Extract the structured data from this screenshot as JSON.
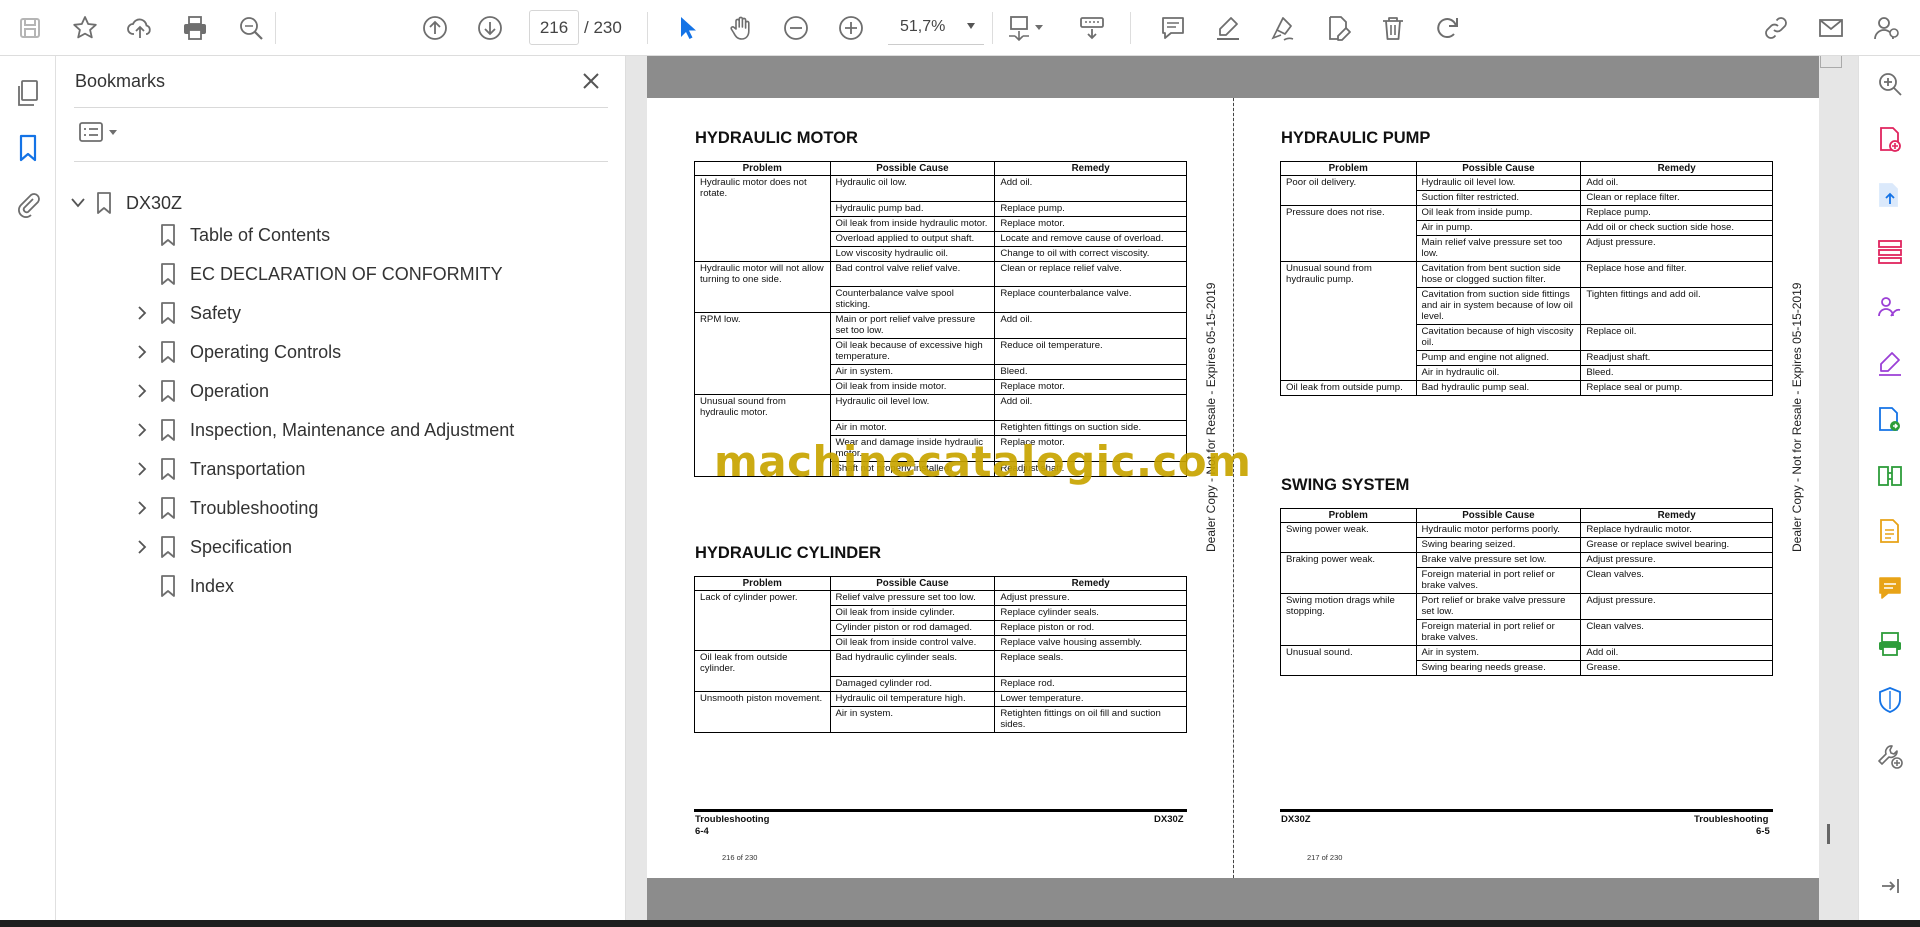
{
  "toolbar": {
    "page_current": "216",
    "page_total": "/  230",
    "zoom": "51,7%"
  },
  "bookmarks_panel": {
    "title": "Bookmarks",
    "root": "DX30Z",
    "items": [
      {
        "label": "Table of Contents",
        "expandable": false
      },
      {
        "label": "EC DECLARATION OF CONFORMITY",
        "expandable": false
      },
      {
        "label": "Safety",
        "expandable": true
      },
      {
        "label": "Operating Controls",
        "expandable": true
      },
      {
        "label": "Operation",
        "expandable": true
      },
      {
        "label": "Inspection, Maintenance and Adjustment",
        "expandable": true
      },
      {
        "label": "Transportation",
        "expandable": true
      },
      {
        "label": "Troubleshooting",
        "expandable": true
      },
      {
        "label": "Specification",
        "expandable": true
      },
      {
        "label": "Index",
        "expandable": false
      }
    ]
  },
  "document": {
    "watermark": "machinecatalogic.com",
    "vertical_note_left": "Dealer Copy - Not for Resale - Expires 05-15-2019",
    "vertical_note_right": "Dealer Copy - Not for Resale - Expires 05-15-2019",
    "table_headers": {
      "problem": "Problem",
      "cause": "Possible Cause",
      "remedy": "Remedy"
    },
    "left_page": {
      "footer_section": "Troubleshooting",
      "footer_page": "6-4",
      "footer_model": "DX30Z",
      "page_counter": "216 of 230",
      "sections": [
        {
          "title": "HYDRAULIC MOTOR",
          "groups": [
            {
              "problem": "Hydraulic motor does not rotate.",
              "rows": [
                [
                  "Hydraulic oil low.",
                  "Add oil."
                ],
                [
                  "Hydraulic pump bad.",
                  "Replace pump."
                ],
                [
                  "Oil leak from inside hydraulic motor.",
                  "Replace motor."
                ],
                [
                  "Overload applied to output shaft.",
                  "Locate and remove cause of overload."
                ],
                [
                  "Low viscosity hydraulic oil.",
                  "Change to oil with correct viscosity."
                ]
              ]
            },
            {
              "problem": "Hydraulic motor will not allow turning to one side.",
              "rows": [
                [
                  "Bad control valve relief valve.",
                  "Clean or replace relief valve."
                ],
                [
                  "Counterbalance valve spool sticking.",
                  "Replace counterbalance valve."
                ]
              ]
            },
            {
              "problem": "RPM low.",
              "rows": [
                [
                  "Main or port relief valve pressure set too low.",
                  "Add oil."
                ],
                [
                  "Oil leak because of excessive high temperature.",
                  "Reduce oil temperature."
                ],
                [
                  "Air in system.",
                  "Bleed."
                ],
                [
                  "Oil leak from inside motor.",
                  "Replace motor."
                ]
              ]
            },
            {
              "problem": "Unusual sound from hydraulic motor.",
              "rows": [
                [
                  "Hydraulic oil level low.",
                  "Add oil."
                ],
                [
                  "Air in motor.",
                  "Retighten fittings on suction side."
                ],
                [
                  "Wear and damage inside hydraulic motor.",
                  "Replace motor."
                ],
                [
                  "Shaft not properly installed.",
                  "Readjust shaft."
                ]
              ]
            }
          ]
        },
        {
          "title": "HYDRAULIC CYLINDER",
          "groups": [
            {
              "problem": "Lack of cylinder power.",
              "rows": [
                [
                  "Relief valve pressure set too low.",
                  "Adjust pressure."
                ],
                [
                  "Oil leak from inside cylinder.",
                  "Replace cylinder seals."
                ],
                [
                  "Cylinder piston or rod damaged.",
                  "Replace piston or rod."
                ],
                [
                  "Oil leak from inside control valve.",
                  "Replace valve housing assembly."
                ]
              ]
            },
            {
              "problem": "Oil leak from outside cylinder.",
              "rows": [
                [
                  "Bad hydraulic cylinder seals.",
                  "Replace seals."
                ],
                [
                  "Damaged cylinder rod.",
                  "Replace rod."
                ]
              ]
            },
            {
              "problem": "Unsmooth piston movement.",
              "rows": [
                [
                  "Hydraulic oil temperature high.",
                  "Lower temperature."
                ],
                [
                  "Air in system.",
                  "Retighten fittings on oil fill and suction sides."
                ]
              ]
            }
          ]
        }
      ]
    },
    "right_page": {
      "footer_section": "Troubleshooting",
      "footer_page": "6-5",
      "footer_model": "DX30Z",
      "page_counter": "217 of 230",
      "sections": [
        {
          "title": "HYDRAULIC PUMP",
          "groups": [
            {
              "problem": "Poor oil delivery.",
              "rows": [
                [
                  "Hydraulic oil level low.",
                  "Add oil."
                ],
                [
                  "Suction filter restricted.",
                  "Clean or replace filter."
                ]
              ]
            },
            {
              "problem": "Pressure does not rise.",
              "rows": [
                [
                  "Oil leak from inside pump.",
                  "Replace pump."
                ],
                [
                  "Air in pump.",
                  "Add oil or check suction side hose."
                ],
                [
                  "Main relief valve pressure set too low.",
                  "Adjust pressure."
                ]
              ]
            },
            {
              "problem": "Unusual sound from hydraulic pump.",
              "rows": [
                [
                  "Cavitation from bent suction side hose or clogged suction filter.",
                  "Replace hose and filter."
                ],
                [
                  "Cavitation from suction side fittings and air in system because of low oil level.",
                  "Tighten fittings and add oil."
                ],
                [
                  "Cavitation because of high viscosity oil.",
                  "Replace oil."
                ],
                [
                  "Pump and engine not aligned.",
                  "Readjust shaft."
                ],
                [
                  "Air in hydraulic oil.",
                  "Bleed."
                ]
              ]
            },
            {
              "problem": "Oil leak from outside pump.",
              "rows": [
                [
                  "Bad hydraulic pump seal.",
                  "Replace seal or pump."
                ]
              ]
            }
          ]
        },
        {
          "title": "SWING SYSTEM",
          "groups": [
            {
              "problem": "Swing power weak.",
              "rows": [
                [
                  "Hydraulic motor performs poorly.",
                  "Replace hydraulic motor."
                ],
                [
                  "Swing bearing seized.",
                  "Grease or replace swivel bearing."
                ]
              ]
            },
            {
              "problem": "Braking power weak.",
              "rows": [
                [
                  "Brake valve pressure set low.",
                  "Adjust pressure."
                ],
                [
                  "Foreign material in port relief or brake valves.",
                  "Clean valves."
                ]
              ]
            },
            {
              "problem": "Swing motion drags while stopping.",
              "rows": [
                [
                  "Port relief or brake valve pressure set low.",
                  "Adjust pressure."
                ],
                [
                  "Foreign material in port relief or brake valves.",
                  "Clean valves."
                ]
              ]
            },
            {
              "problem": "Unusual sound.",
              "rows": [
                [
                  "Air in system.",
                  "Add oil."
                ],
                [
                  "Swing bearing needs grease.",
                  "Grease."
                ]
              ]
            }
          ]
        }
      ]
    }
  },
  "colors": {
    "accent_blue": "#1473e6",
    "icon_gray": "#6e6e6e",
    "tool_magenta": "#e0245e",
    "tool_blue": "#1473e6",
    "tool_purple": "#9b3fd6",
    "tool_green": "#2d9d3a",
    "tool_orange": "#e8a317",
    "watermark_gold": "#c8a400"
  }
}
